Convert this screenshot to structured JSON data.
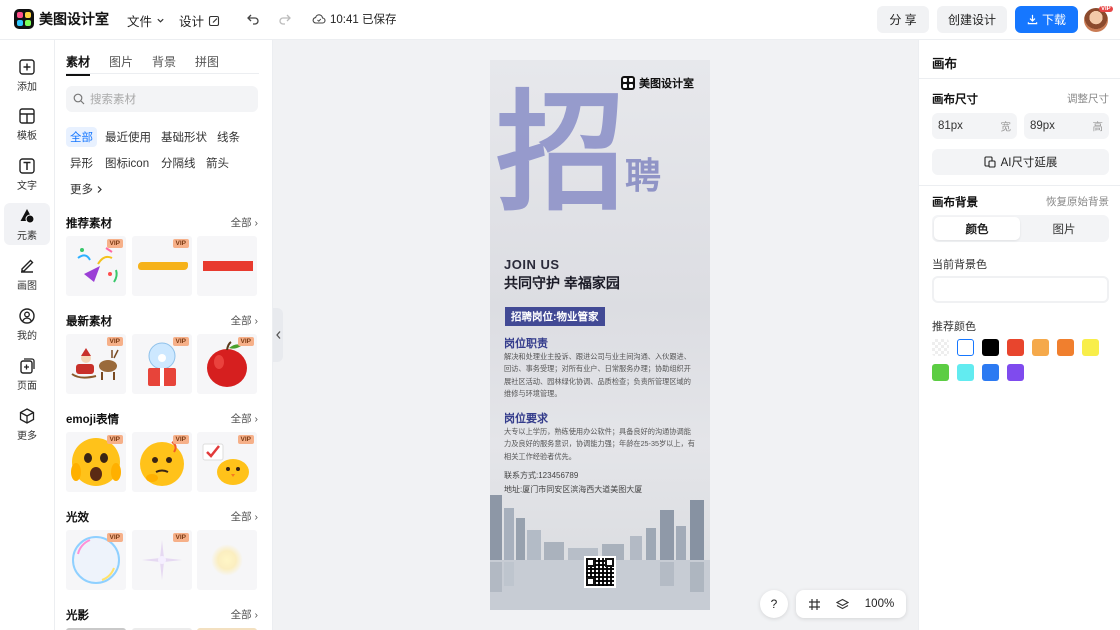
{
  "app": {
    "name": "美图设计室"
  },
  "topbar": {
    "file_menu": "文件",
    "design_menu": "设计",
    "save_status": "10:41 已保存",
    "share_label": "分 享",
    "create_label": "创建设计",
    "download_label": "下载",
    "avatar_badge": "VIP"
  },
  "rail": {
    "items": [
      {
        "label": "添加",
        "icon": "plus-square-icon"
      },
      {
        "label": "模板",
        "icon": "template-icon"
      },
      {
        "label": "文字",
        "icon": "text-icon"
      },
      {
        "label": "元素",
        "icon": "shapes-icon"
      },
      {
        "label": "画图",
        "icon": "draw-icon"
      },
      {
        "label": "我的",
        "icon": "user-icon"
      },
      {
        "label": "页面",
        "icon": "page-add-icon"
      },
      {
        "label": "更多",
        "icon": "cube-icon"
      }
    ],
    "active": "元素"
  },
  "panel": {
    "tabs": [
      "素材",
      "图片",
      "背景",
      "拼图"
    ],
    "active_tab": "素材",
    "search_placeholder": "搜索素材",
    "chips": [
      "全部",
      "最近使用",
      "基础形状",
      "线条",
      "异形",
      "图标icon",
      "分隔线",
      "箭头",
      "更多"
    ],
    "sections": [
      {
        "title": "推荐素材",
        "all": "全部"
      },
      {
        "title": "最新素材",
        "all": "全部"
      },
      {
        "title": "emoji表情",
        "all": "全部"
      },
      {
        "title": "光效",
        "all": "全部"
      },
      {
        "title": "光影",
        "all": "全部"
      }
    ],
    "vip_label": "VIP"
  },
  "poster": {
    "brand": "美图设计室",
    "big_char": "招",
    "small_chars": "聘",
    "join_us": "JOIN US",
    "slogan": "共同守护 幸福家园",
    "position_tag": "招聘岗位:物业管家",
    "duty_title": "岗位职责",
    "duty_text": "解决和处理业主投诉、跟进公司与业主间沟通、入伙跟进、回访、事务受理；对所有业户、日常服务办理；协助组织开展社区活动、园林绿化协调、品质检查；负责所管理区域的维修与环境管理。",
    "req_title": "岗位要求",
    "req_text": "大专以上学历，熟练使用办公软件；具备良好的沟通协调能力及良好的服务意识，协调能力强；年龄在25-35岁以上，有相关工作经验者优先。",
    "contact": "联系方式:123456789",
    "address": "地址:厦门市同安区滨海西大道美图大厦"
  },
  "canvas_toolbar": {
    "help": "?",
    "zoom": "100%"
  },
  "rpanel": {
    "title": "画布",
    "size_label": "画布尺寸",
    "adjust_label": "调整尺寸",
    "width_value": "81px",
    "width_unit": "宽",
    "height_value": "89px",
    "height_unit": "高",
    "ai_extend": "AI尺寸延展",
    "bg_label": "画布背景",
    "restore_label": "恢复原始背景",
    "tab_color": "颜色",
    "tab_image": "图片",
    "current_bg_label": "当前背景色",
    "recommend_label": "推荐颜色",
    "colors": [
      "transparent",
      "#ffffff",
      "#000000",
      "#e8452d",
      "#f5a94b",
      "#f07f2e",
      "#f8ee4a",
      "#5ccd43",
      "#62ebf0",
      "#2c7af2",
      "#7f4bee"
    ]
  },
  "accent": "#1677ff"
}
